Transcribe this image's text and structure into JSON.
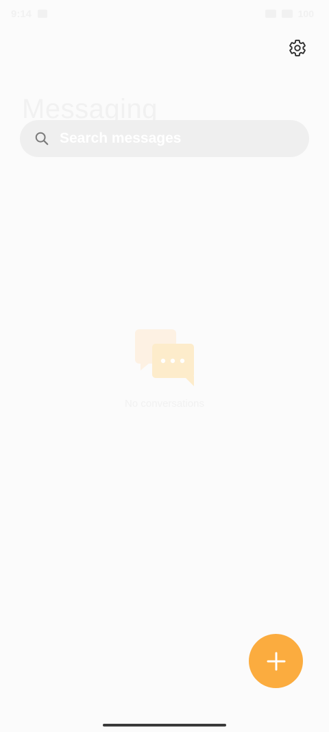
{
  "status_bar": {
    "time": "9:14",
    "battery": "100"
  },
  "header": {
    "title": "Messaging"
  },
  "search": {
    "placeholder": "Search messages"
  },
  "empty_state": {
    "message": "No conversations"
  },
  "icons": {
    "settings": "gear-icon",
    "search": "search-icon",
    "fab": "plus-icon",
    "empty": "chat-bubbles-icon"
  },
  "colors": {
    "accent": "#fbac3f",
    "illustration_light": "#fdf1e3",
    "illustration_main": "#fdeccb"
  }
}
